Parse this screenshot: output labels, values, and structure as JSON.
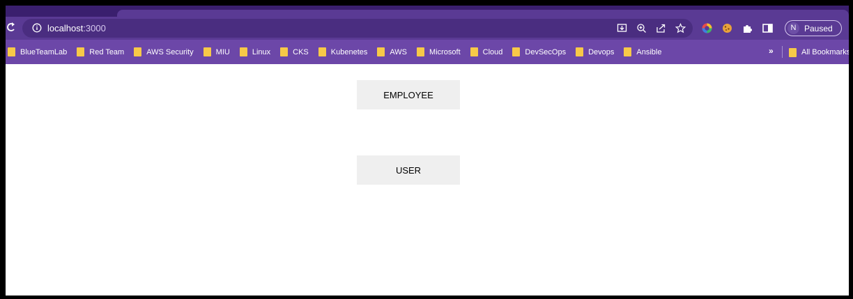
{
  "browser": {
    "url_host": "localhost",
    "url_port": ":3000",
    "profile": {
      "initial": "N",
      "status": "Paused"
    },
    "bookmarks": [
      {
        "label": "BlueTeamLab"
      },
      {
        "label": "Red Team"
      },
      {
        "label": "AWS Security"
      },
      {
        "label": "MIU"
      },
      {
        "label": "Linux"
      },
      {
        "label": "CKS"
      },
      {
        "label": "Kubenetes"
      },
      {
        "label": "AWS"
      },
      {
        "label": "Microsoft"
      },
      {
        "label": "Cloud"
      },
      {
        "label": "DevSecOps"
      },
      {
        "label": "Devops"
      },
      {
        "label": "Ansible"
      }
    ],
    "bookmarks_overflow": "»",
    "all_bookmarks_label": "All Bookmarks",
    "icons": {
      "reload": "reload-icon",
      "info": "info-icon",
      "install": "install-icon",
      "zoom": "zoom-icon",
      "share": "share-icon",
      "bookmark_star": "star-icon",
      "extension_color": "color-circle-icon",
      "extension_cookie": "cookie-icon",
      "extensions": "puzzle-icon",
      "side_panel": "side-panel-icon"
    }
  },
  "page": {
    "buttons": {
      "employee": "EMPLOYEE",
      "user": "USER"
    }
  },
  "colors": {
    "toolbar": "#5a3a94",
    "bookmarks_bar": "#6c47a8",
    "folder": "#f7c948",
    "button_bg": "#efefef"
  }
}
